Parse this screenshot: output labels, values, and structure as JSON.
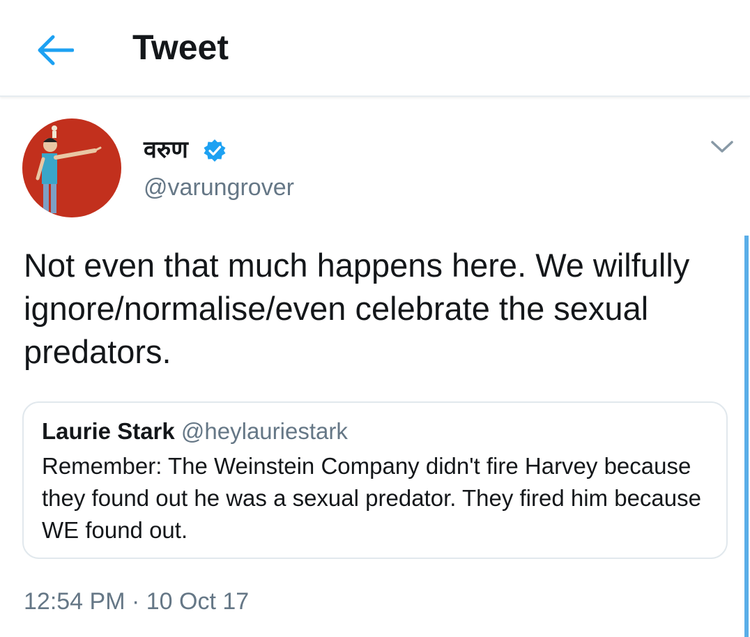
{
  "header": {
    "title": "Tweet",
    "back_icon": "arrow-left-icon"
  },
  "author": {
    "display_name": "वरुण",
    "handle": "@varungrover",
    "verified_icon": "verified-badge-icon"
  },
  "tweet": {
    "text": "Not even that much happens here. We wilfully ignore/normalise/even celebrate the sexual predators.",
    "timestamp": "12:54 PM · 10 Oct 17"
  },
  "quoted_tweet": {
    "name": "Laurie Stark",
    "handle": "@heylauriestark",
    "text": "Remember: The Weinstein Company didn't fire Harvey because they found out he was a sexual predator. They fired him because WE found out."
  },
  "colors": {
    "accent": "#1da1f2",
    "secondary_text": "#657786",
    "avatar_bg": "#c8321f"
  }
}
